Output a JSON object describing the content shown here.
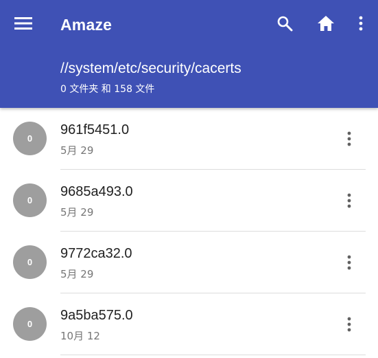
{
  "colors": {
    "appbar": "#3f51b5",
    "avatar": "#9e9e9e",
    "divider": "#dcdcdc",
    "primary_text": "#212121",
    "secondary_text": "#757575"
  },
  "toolbar": {
    "menu_icon": "hamburger-menu-icon",
    "title": "Amaze",
    "search_icon": "search-icon",
    "home_icon": "home-icon",
    "more_icon": "more-vert-icon"
  },
  "location": {
    "path": "//system/etc/security/cacerts",
    "summary": "0 文件夹 和 158 文件"
  },
  "files": [
    {
      "avatar_text": "0",
      "name": "961f5451.0",
      "date": "5月 29",
      "menu_icon": "more-vert-icon"
    },
    {
      "avatar_text": "0",
      "name": "9685a493.0",
      "date": "5月 29",
      "menu_icon": "more-vert-icon"
    },
    {
      "avatar_text": "0",
      "name": "9772ca32.0",
      "date": "5月 29",
      "menu_icon": "more-vert-icon"
    },
    {
      "avatar_text": "0",
      "name": "9a5ba575.0",
      "date": "10月 12",
      "menu_icon": "more-vert-icon"
    }
  ]
}
